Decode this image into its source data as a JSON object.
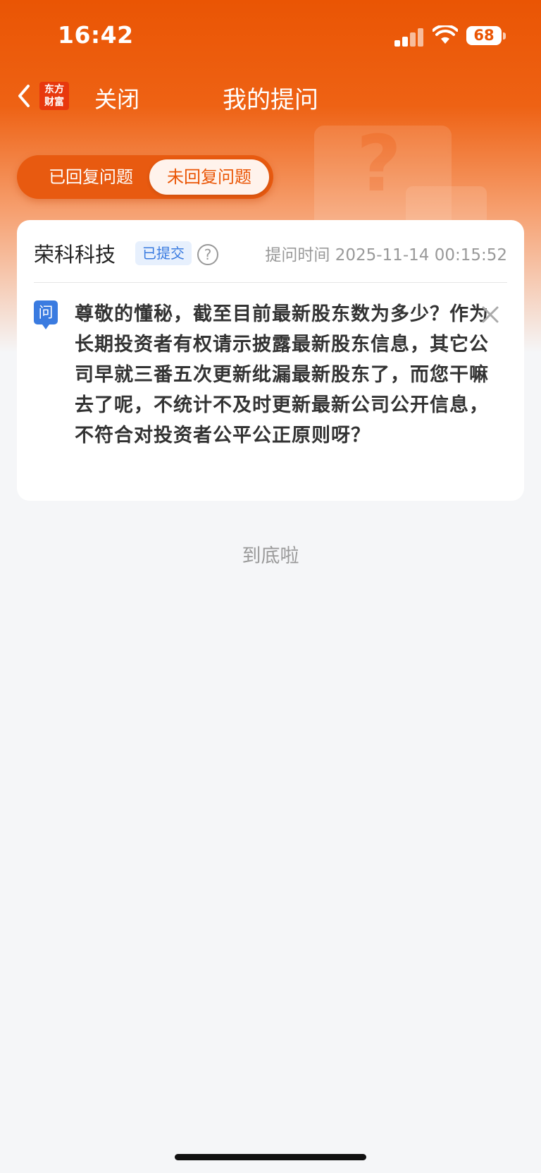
{
  "status_bar": {
    "time": "16:42",
    "battery": "68"
  },
  "nav": {
    "logo_line1": "东方",
    "logo_line2": "财富",
    "close_label": "关闭",
    "title": "我的提问"
  },
  "tabs": {
    "answered": "已回复问题",
    "unanswered": "未回复问题",
    "active": "unanswered"
  },
  "card": {
    "company": "荣科科技",
    "status_badge": "已提交",
    "help_glyph": "?",
    "ask_time": "提问时间 2025-11-14 00:15:52",
    "question_icon": "问",
    "question_text": "尊敬的懂秘，截至目前最新股东数为多少？作为长期投资者有权请示披露最新股东信息，其它公司早就三番五次更新纰漏最新股东了，而您干嘛去了呢，不统计不及时更新最新公司公开信息，不符合对投资者公平公正原则呀？"
  },
  "footer": {
    "end_text": "到底啦"
  },
  "colors": {
    "brand": "#ea5504",
    "accent_blue": "#3a7be0",
    "background": "#f5f6f8"
  }
}
